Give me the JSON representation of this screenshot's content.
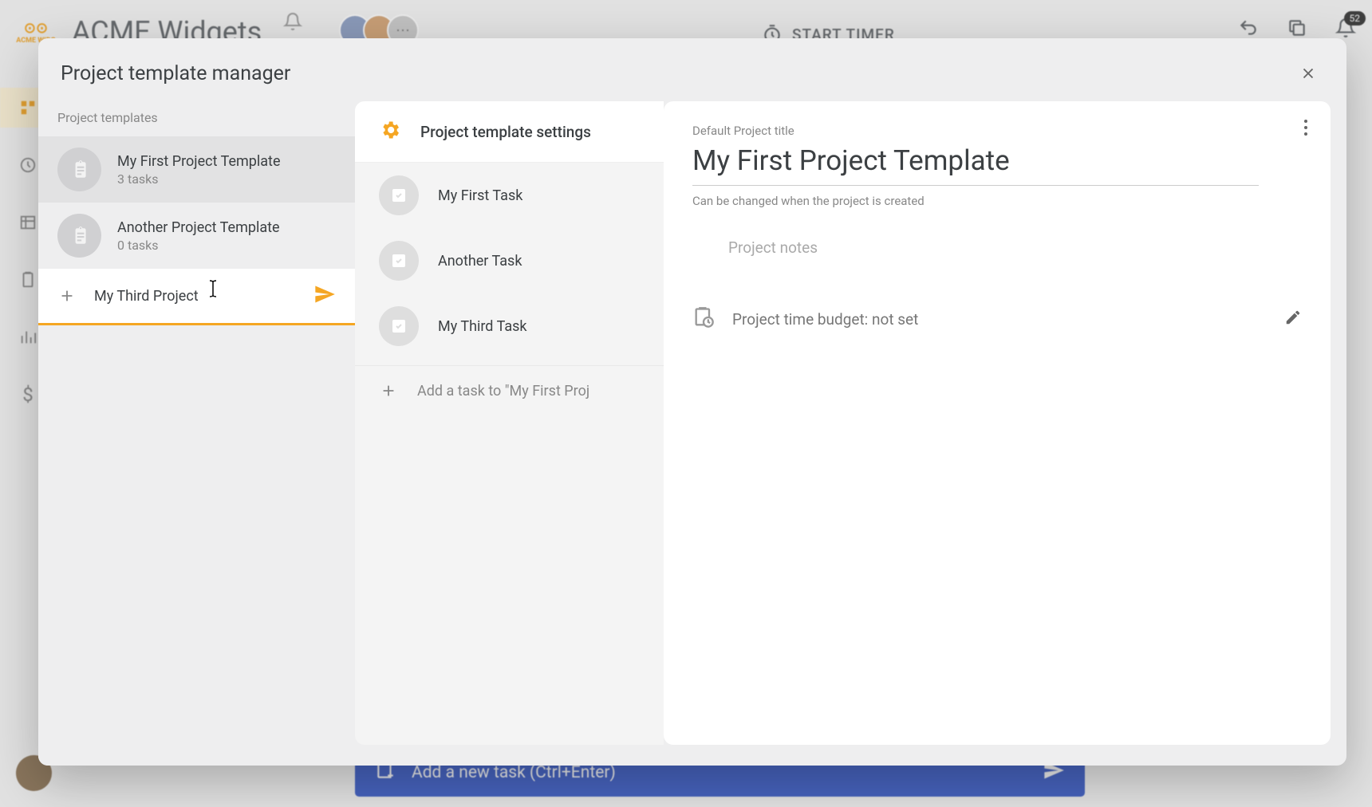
{
  "bg": {
    "logo_text": "ACME WIDG",
    "app_title": "ACME Widgets",
    "timer_label": "START TIMER",
    "badge_count": "52",
    "add_task_label": "Add a new task (Ctrl+Enter)",
    "avatar_more": "⋯"
  },
  "modal": {
    "title": "Project template manager",
    "list_label": "Project templates",
    "templates": [
      {
        "name": "My First Project Template",
        "sub": "3 tasks"
      },
      {
        "name": "Another Project Template",
        "sub": "0 tasks"
      }
    ],
    "new_template_value": "My Third Project ",
    "settings_label": "Project template settings",
    "tasks": [
      {
        "name": "My First Task"
      },
      {
        "name": "Another Task"
      },
      {
        "name": "My Third Task"
      }
    ],
    "add_task_label": "Add a task to \"My First Proj",
    "detail": {
      "field_label": "Default Project title",
      "title": "My First Project Template",
      "hint": "Can be changed when the project is created",
      "notes_placeholder": "Project notes",
      "budget_text": "Project time budget: not set"
    }
  }
}
